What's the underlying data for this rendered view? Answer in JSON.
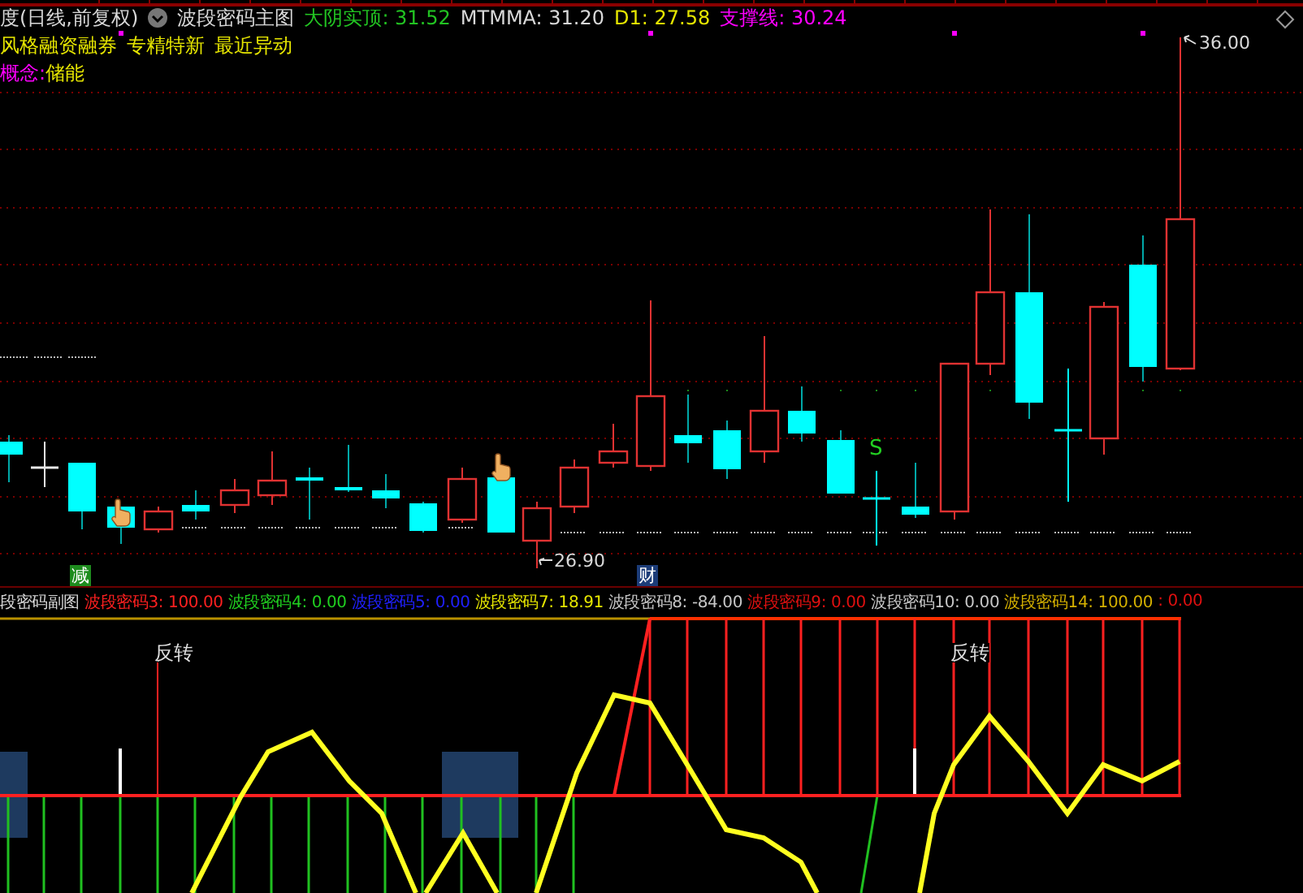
{
  "header": {
    "title": "度(日线,前复权)",
    "indicator": "波段密码主图",
    "values": [
      {
        "text": "大阴实顶: 31.52",
        "color": "#22c322"
      },
      {
        "text": "MTMMA: 31.20",
        "color": "#d8d8d8"
      },
      {
        "text": "D1: 27.58",
        "color": "#e6e600"
      },
      {
        "text": "支撑线: 30.24",
        "color": "#ff00ff"
      }
    ]
  },
  "tags": [
    "风格融资融券",
    "专精特新",
    "最近异动"
  ],
  "concept": {
    "label": "概念:",
    "value": "储能"
  },
  "chart": {
    "markers": [
      {
        "kind": "price",
        "text": "36.00"
      },
      {
        "kind": "price",
        "text": "26.90"
      },
      {
        "kind": "badge",
        "text": "减",
        "color": "#1e8c1e"
      },
      {
        "kind": "badge",
        "text": "财",
        "color": "#1c3c78"
      },
      {
        "kind": "signal",
        "text": "S"
      }
    ]
  },
  "legend": {
    "title": "段密码副图",
    "items": [
      {
        "text": "波段密码3: 100.00",
        "color": "#ff2020"
      },
      {
        "text": "波段密码4: 0.00",
        "color": "#20d020"
      },
      {
        "text": "波段密码5: 0.00",
        "color": "#2020ff"
      },
      {
        "text": "波段密码7: 18.91",
        "color": "#e6e600"
      },
      {
        "text": "波段密码8: -84.00",
        "color": "#c8c8c8"
      },
      {
        "text": "波段密码9: 0.00",
        "color": "#e01010"
      },
      {
        "text": "波段密码10: 0.00",
        "color": "#c8c8c8"
      },
      {
        "text": "波段密码14: 100.00",
        "color": "#d4b000"
      },
      {
        "text": ": 0.00",
        "color": "#e01010"
      }
    ]
  },
  "sub_chart": {
    "labels": [
      "反转",
      "反转"
    ]
  }
}
